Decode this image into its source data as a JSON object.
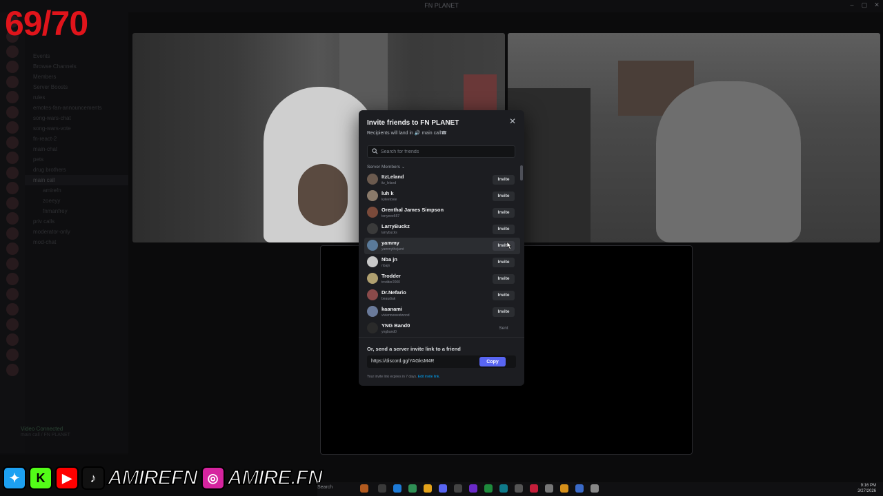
{
  "window": {
    "title": "FN PLANET"
  },
  "overlay": {
    "counter": "69/70"
  },
  "sidebar": {
    "channels": [
      {
        "label": "Events",
        "kind": "item"
      },
      {
        "label": "Browse Channels",
        "kind": "item"
      },
      {
        "label": "Members",
        "kind": "item"
      },
      {
        "label": "Server Boosts",
        "kind": "item"
      },
      {
        "label": "rules",
        "kind": "item"
      },
      {
        "label": "emotes-fan-announcements",
        "kind": "item"
      },
      {
        "label": "song-wars-chat",
        "kind": "item"
      },
      {
        "label": "song-wars-vote",
        "kind": "item"
      },
      {
        "label": "fn-react-2",
        "kind": "item"
      },
      {
        "label": "main-chat",
        "kind": "item"
      },
      {
        "label": "pets",
        "kind": "item"
      },
      {
        "label": "drug brothers",
        "kind": "item"
      },
      {
        "label": "main call",
        "kind": "selected"
      },
      {
        "label": "amirefn",
        "kind": "sub"
      },
      {
        "label": "zoeeyy",
        "kind": "sub"
      },
      {
        "label": "fnmanfrey",
        "kind": "sub"
      },
      {
        "label": "priv calls",
        "kind": "item"
      },
      {
        "label": "moderator-only",
        "kind": "item"
      },
      {
        "label": "mod-chat",
        "kind": "item"
      }
    ],
    "voice": {
      "status": "Video Connected",
      "location": "main call / FN PLANET"
    }
  },
  "modal": {
    "title": "Invite friends to FN PLANET",
    "subtitle": "Recipients will land in 🔊 main call☎",
    "search_placeholder": "Search for friends",
    "section_label": "Server Members",
    "members": [
      {
        "name": "ItzLeland",
        "username": "itz_leland",
        "action": "Invite",
        "state": "invite",
        "color": "#6b5a4e"
      },
      {
        "name": "luh k",
        "username": "kyleetoxie",
        "action": "Invite",
        "state": "invite",
        "color": "#8a7a6a"
      },
      {
        "name": "Orenthal James Simpson",
        "username": "tonyeee667",
        "action": "Invite",
        "state": "invite",
        "color": "#7a4a3a"
      },
      {
        "name": "LarryBuckz",
        "username": "larrybucks",
        "action": "Invite",
        "state": "invite",
        "color": "#3a3a3a"
      },
      {
        "name": "yammy",
        "username": "yammythejamt",
        "action": "Invite",
        "state": "hover",
        "color": "#5a7a9a"
      },
      {
        "name": "Nba jn",
        "username": "nbajn",
        "action": "Invite",
        "state": "invite",
        "color": "#c8c8c8"
      },
      {
        "name": "Trodder",
        "username": "trodder2000",
        "action": "Invite",
        "state": "invite",
        "color": "#b0a070"
      },
      {
        "name": "Dr.Nefario",
        "username": "beaudiak",
        "action": "Invite",
        "state": "invite",
        "color": "#8a4a4a"
      },
      {
        "name": "kaanami",
        "username": "viviennewestwood",
        "action": "Invite",
        "state": "invite",
        "color": "#6a7a9a"
      },
      {
        "name": "YNG Band0",
        "username": "yngband0",
        "action": "Sent",
        "state": "sent",
        "color": "#2a2a2a"
      }
    ],
    "link_label": "Or, send a server invite link to a friend",
    "invite_url": "https://discord.gg/YAGksM4R",
    "copy_label": "Copy",
    "expiry_text": "Your invite link expires in 7 days.",
    "edit_link_label": "Edit invite link."
  },
  "social": {
    "handle_primary": "AMIREFN",
    "handle_secondary": "AMIRE.FN",
    "icons": [
      "twitter-icon",
      "kick-icon",
      "youtube-icon",
      "tiktok-icon",
      "instagram-icon"
    ]
  },
  "taskbar": {
    "search_label": "Search",
    "time": "9:16 PM",
    "date": "3/27/2026"
  }
}
